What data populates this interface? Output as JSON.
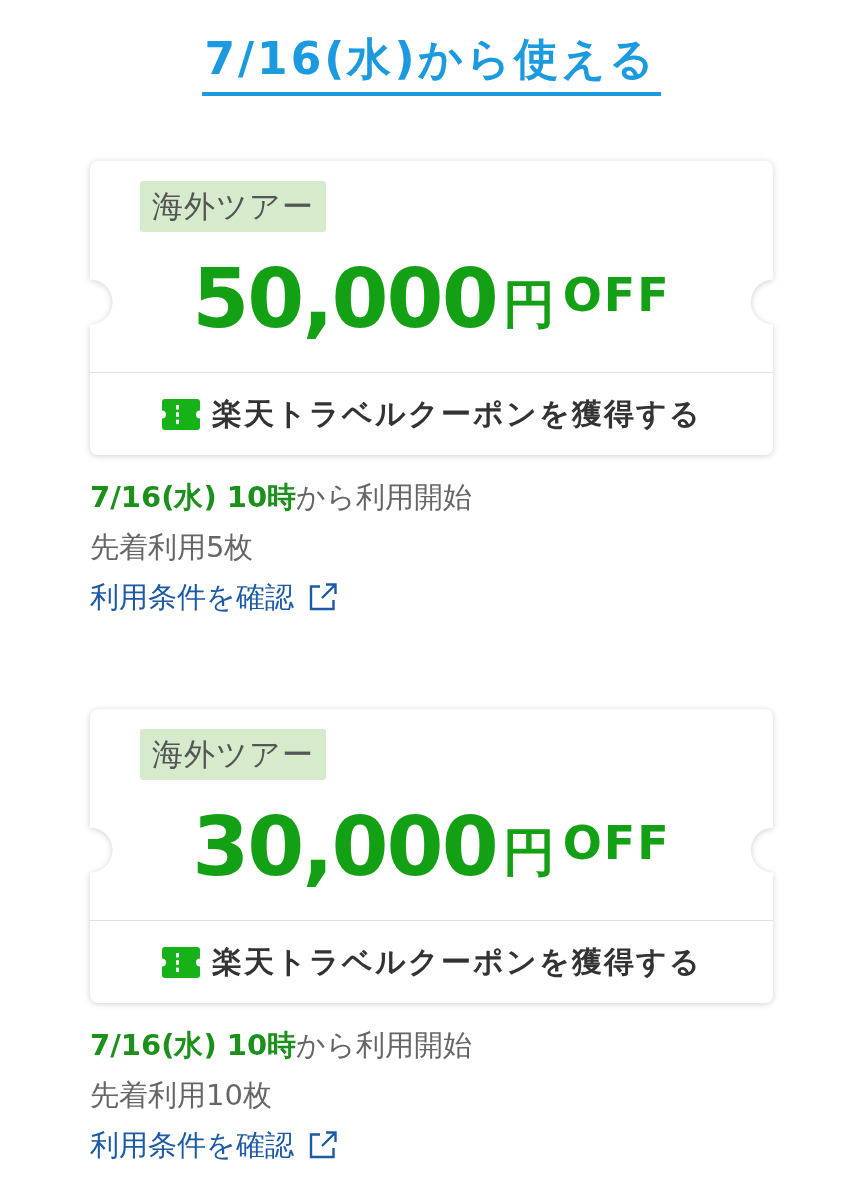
{
  "heading": "7/16(水)から使える",
  "coupons": [
    {
      "category": "海外ツアー",
      "amount": "50,000",
      "unit": "円",
      "suffix": "OFF",
      "button": "楽天トラベルクーポンを獲得する",
      "start": "**7/16(水) 10時**から利用開始",
      "limit": "先着利用5枚",
      "terms_link": "利用条件を確認"
    },
    {
      "category": "海外ツアー",
      "amount": "30,000",
      "unit": "円",
      "suffix": "OFF",
      "button": "楽天トラベルクーポンを獲得する",
      "start": "**7/16(水) 10時**から利用開始",
      "limit": "先着利用10枚",
      "terms_link": "利用条件を確認"
    }
  ]
}
